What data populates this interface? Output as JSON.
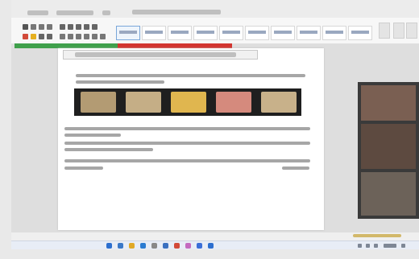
{
  "window": {
    "title": "",
    "app_label": ""
  },
  "ribbon": {
    "styles_count_hint": "styles gallery"
  },
  "document": {
    "heading": "",
    "paragraph_1": "",
    "paragraph_2": "",
    "paragraph_3": "",
    "paragraph_4": "",
    "photos": [
      {
        "icon": "dish-photo-1",
        "color": "#b39b73"
      },
      {
        "icon": "dish-photo-2",
        "color": "#c5ae86"
      },
      {
        "icon": "dish-photo-3",
        "color": "#e0b64f"
      },
      {
        "icon": "dish-photo-4",
        "color": "#d58a7d"
      },
      {
        "icon": "dish-photo-5",
        "color": "#c8b18a"
      }
    ]
  },
  "colors": {
    "green_bar": "#3fa04b",
    "red_bar": "#d2342f",
    "taskbar_icon_blue": "#2d6fcf"
  }
}
